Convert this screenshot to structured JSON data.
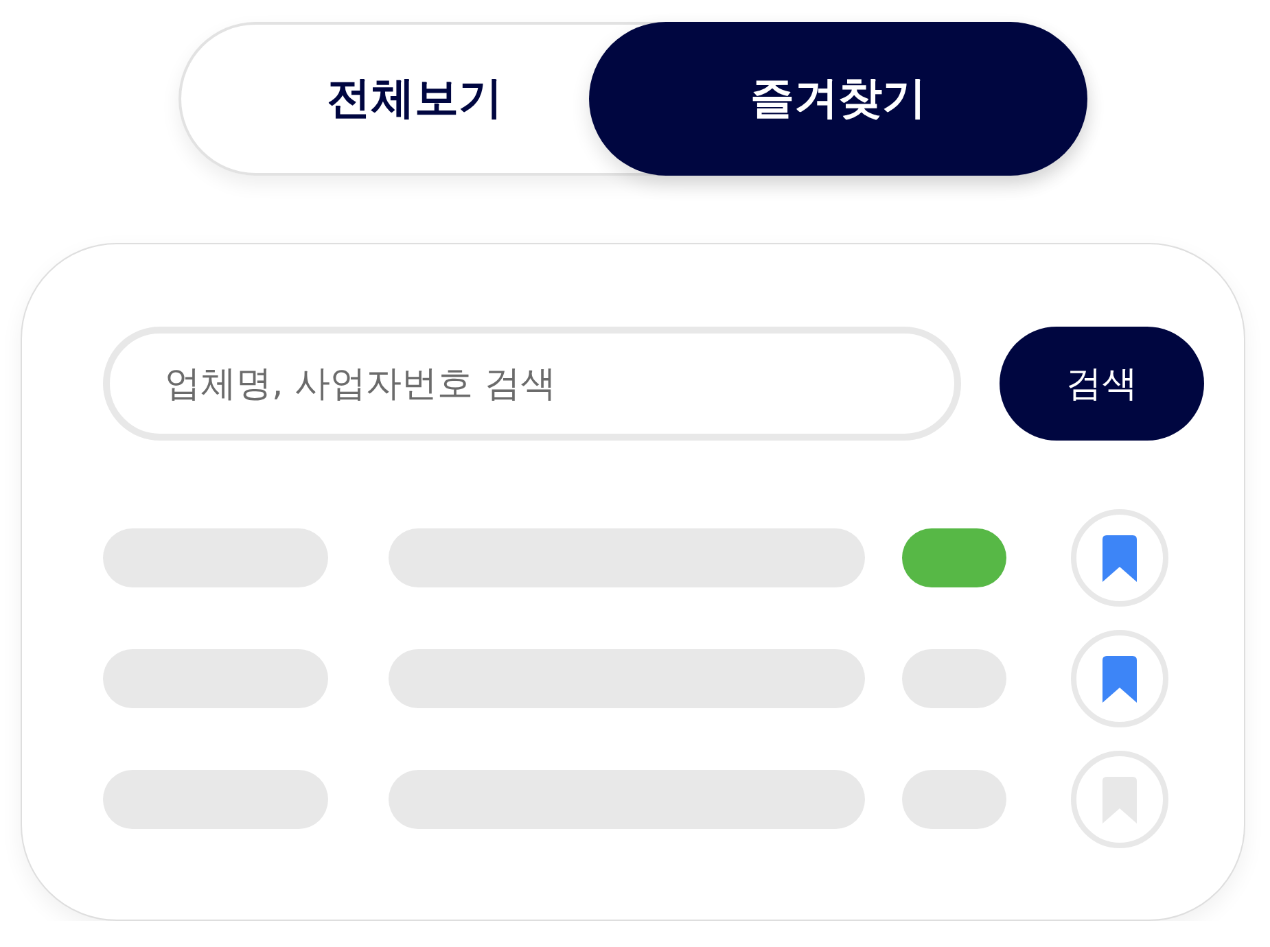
{
  "view_tabs": [
    {
      "label": "전체보기",
      "selected": false
    },
    {
      "label": "즐겨찾기",
      "selected": true
    }
  ],
  "search": {
    "placeholder": "업체명, 사업자번호 검색",
    "button": "검색"
  },
  "rows": [
    {
      "tag": {
        "color": "#57b846"
      },
      "bookmarked": true
    },
    {
      "tag": {
        "color": "#e8e8e8"
      },
      "bookmarked": true
    },
    {
      "tag": {
        "color": "#e8e8e8"
      },
      "bookmarked": false
    }
  ]
}
